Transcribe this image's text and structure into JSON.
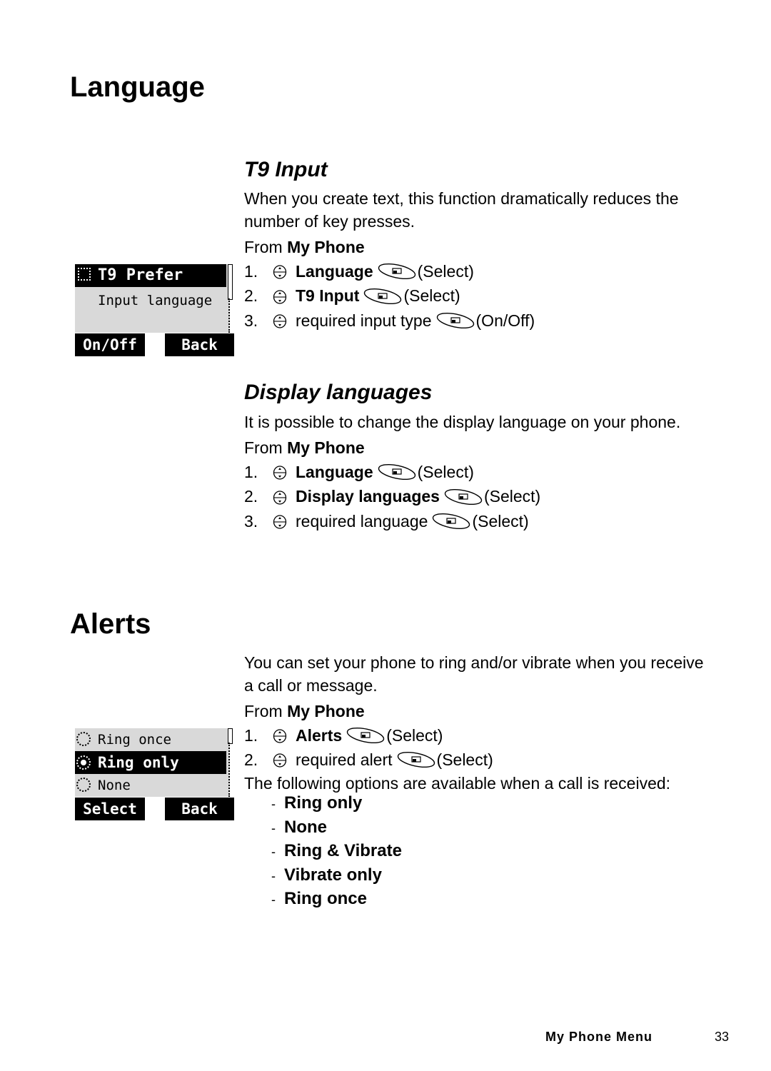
{
  "language_section": {
    "title": "Language",
    "t9": {
      "heading": "T9 Input",
      "description": "When you create text, this function dramatically reduces the number of key presses.",
      "from_label": "From",
      "from_menu": "My Phone",
      "steps": [
        {
          "num": "1.",
          "bold": "Language",
          "text": "",
          "action": "(Select)"
        },
        {
          "num": "2.",
          "bold": "T9 Input",
          "text": "",
          "action": "(Select)"
        },
        {
          "num": "3.",
          "bold": "",
          "text": "required input type",
          "action": "(On/Off)"
        }
      ],
      "screen": {
        "title": "T9 Prefer",
        "line": "Input language",
        "left_soft": "On/Off",
        "right_soft": "Back"
      }
    },
    "display": {
      "heading": "Display languages",
      "description": "It is possible to change the display language on your phone.",
      "from_label": "From",
      "from_menu": "My Phone",
      "steps": [
        {
          "num": "1.",
          "bold": "Language",
          "text": "",
          "action": "(Select)"
        },
        {
          "num": "2.",
          "bold": "Display languages",
          "text": "",
          "action": "(Select)"
        },
        {
          "num": "3.",
          "bold": "",
          "text": "required language",
          "action": "(Select)"
        }
      ]
    }
  },
  "alerts_section": {
    "title": "Alerts",
    "description": "You can set your phone to ring and/or vibrate when you receive a call or message.",
    "from_label": "From",
    "from_menu": "My Phone",
    "steps": [
      {
        "num": "1.",
        "bold": "Alerts",
        "text": "",
        "action": "(Select)"
      },
      {
        "num": "2.",
        "bold": "",
        "text": "required alert",
        "action": "(Select)"
      }
    ],
    "options_intro": "The following options are available when a call is received:",
    "options": [
      "Ring only",
      "None",
      "Ring & Vibrate",
      "Vibrate only",
      "Ring once"
    ],
    "screen": {
      "items": [
        "Ring once",
        "Ring only",
        "None"
      ],
      "selected_index": 1,
      "left_soft": "Select",
      "right_soft": "Back"
    }
  },
  "footer": {
    "section": "My Phone Menu",
    "page": "33"
  },
  "icons": {
    "nav": "navigation-key-icon",
    "select": "select-softkey-icon"
  }
}
